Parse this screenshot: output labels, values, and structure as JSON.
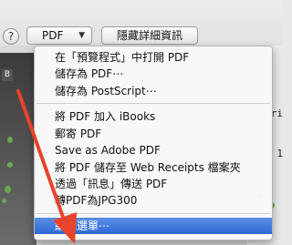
{
  "dialog": {
    "help_label": "?",
    "pdf_button_label": "PDF",
    "hide_details_label": "隱藏詳細資訊"
  },
  "preview": {
    "badge_label": "B",
    "side_labels": [
      "ri",
      "1"
    ]
  },
  "menu": {
    "items": [
      {
        "label": "在「預覽程式」中打開 PDF"
      },
      {
        "label": "儲存為 PDF⋯"
      },
      {
        "label": "儲存為 PostScript⋯"
      },
      {
        "label": "將 PDF 加入 iBooks"
      },
      {
        "label": "郵寄 PDF"
      },
      {
        "label": "Save as Adobe PDF"
      },
      {
        "label": "將 PDF 儲存至 Web Receipts 檔案夾"
      },
      {
        "label": "透過「訊息」傳送 PDF"
      },
      {
        "label": "轉PDF為JPG300"
      },
      {
        "label": "編輯選單⋯",
        "selected": true
      }
    ]
  },
  "colors": {
    "accent": "#2f67d6",
    "annotation_arrow": "#e8442a"
  }
}
